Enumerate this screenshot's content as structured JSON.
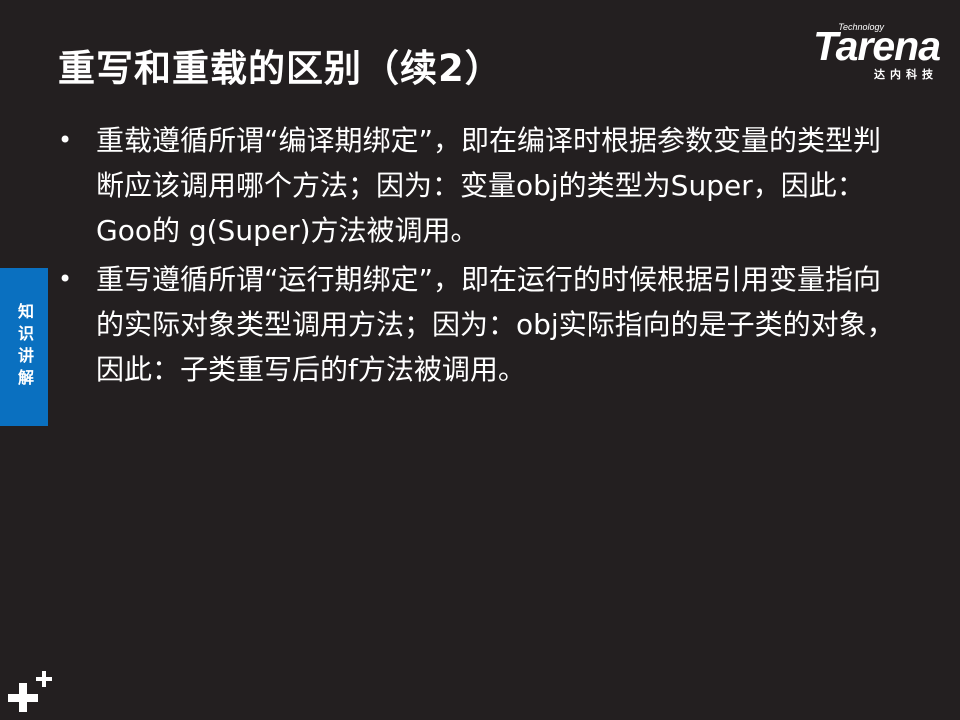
{
  "slide": {
    "title": "重写和重载的区别（续2）",
    "logo": {
      "technology": "Technology",
      "brand": "Tarena",
      "chinese": "达内科技"
    },
    "side_tab": "知识讲解",
    "bullets": [
      {
        "marker": "•",
        "text": "重载遵循所谓“编译期绑定”，即在编译时根据参数变量的类型判断应该调用哪个方法；因为：变量obj的类型为Super，因此：Goo的 g(Super)方法被调用。"
      },
      {
        "marker": "•",
        "text": "重写遵循所谓“运行期绑定”，即在运行的时候根据引用变量指向的实际对象类型调用方法；因为：obj实际指向的是子类的对象，因此：子类重写后的f方法被调用。"
      }
    ]
  }
}
